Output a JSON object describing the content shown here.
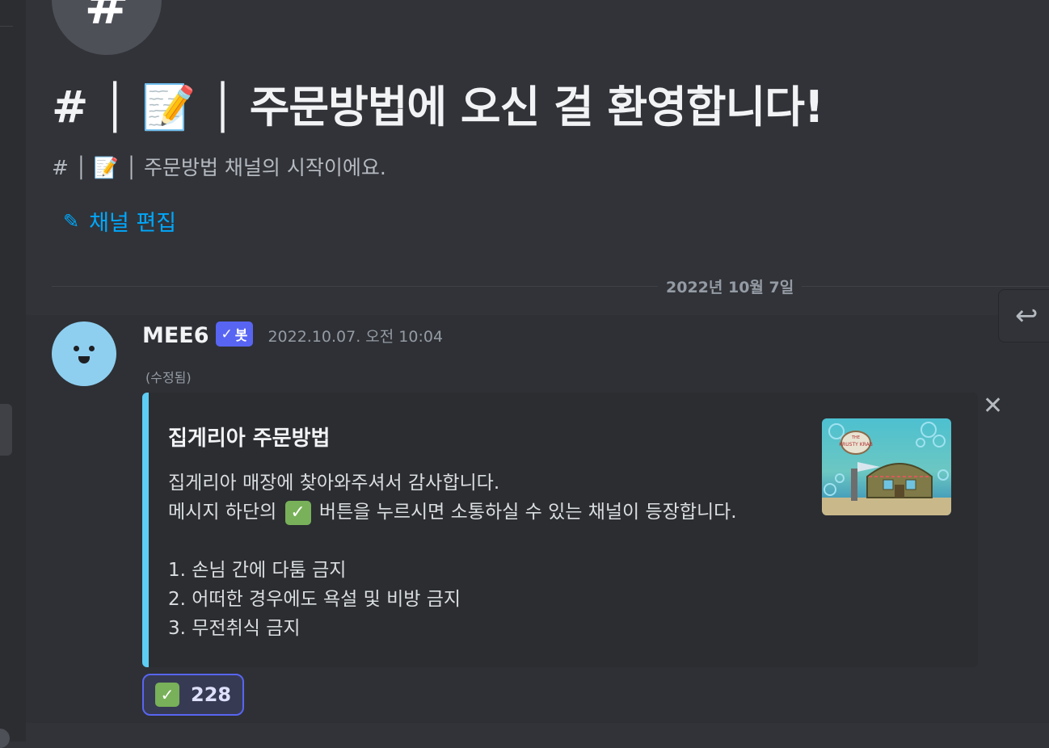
{
  "channel_header": {
    "icon_glyph": "#",
    "welcome_title": "# │ 📝 │ 주문방법에 오신 걸 환영합니다!",
    "welcome_subtitle": "# │ 📝 │ 주문방법 채널의 시작이에요.",
    "edit_channel_label": "채널 편집"
  },
  "date_divider": "2022년 10월 7일",
  "message": {
    "author": "MEE6",
    "bot_tag": "봇",
    "timestamp": "2022.10.07. 오전 10:04",
    "edited": "(수정됨)",
    "embed": {
      "accent_color": "#5ecdf4",
      "title": "집게리아 주문방법",
      "line1": "집게리아 매장에 찾아와주셔서 감사합니다.",
      "line2_before": "메시지 하단의",
      "line2_after": "버튼을 누르시면 소통하실 수 있는 채널이 등장합니다.",
      "rules": [
        "1. 손님 간에 다툼 금지",
        "2. 어떠한 경우에도 욕설 및 비방 금지",
        "3. 무전취식 금지"
      ],
      "thumbnail": {
        "sign_line1": "THE",
        "sign_line2": "KRUSTY KRAB"
      }
    },
    "reaction": {
      "emoji": "check-mark-button",
      "count": "228"
    }
  },
  "colors": {
    "background": "#313338",
    "link": "#00a8fc",
    "blurple": "#5865f2",
    "check_green": "#78b159"
  }
}
